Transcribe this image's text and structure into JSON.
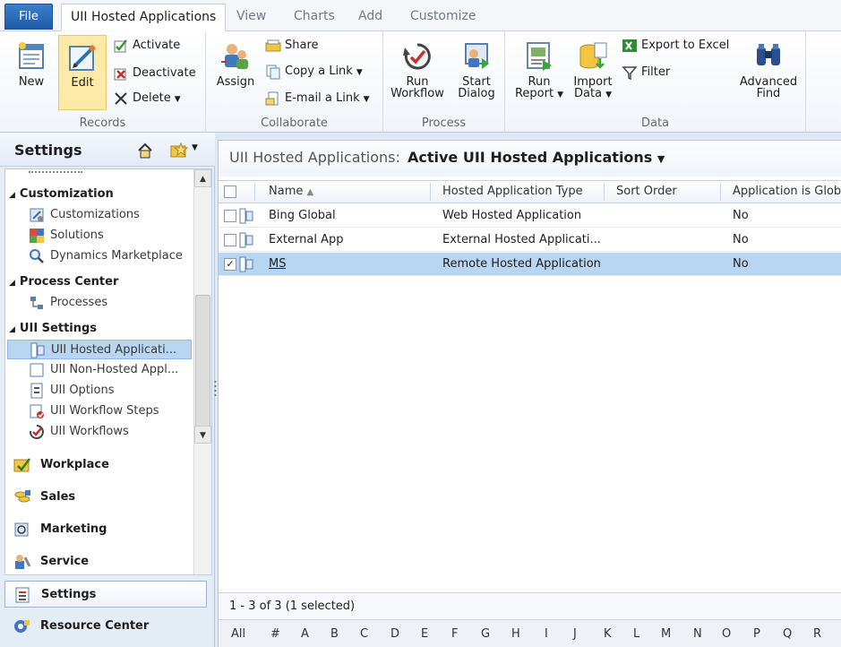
{
  "tabs": {
    "file": "File",
    "items": [
      "UII Hosted Applications",
      "View",
      "Charts",
      "Add",
      "Customize"
    ]
  },
  "ribbon": {
    "records": {
      "label": "Records",
      "new": "New",
      "edit": "Edit",
      "activate": "Activate",
      "deactivate": "Deactivate",
      "delete": "Delete"
    },
    "collaborate": {
      "label": "Collaborate",
      "assign": "Assign",
      "share": "Share",
      "copy_link": "Copy a Link",
      "email_link": "E-mail a Link"
    },
    "process": {
      "label": "Process",
      "run_workflow_1": "Run",
      "run_workflow_2": "Workflow",
      "start_dialog_1": "Start",
      "start_dialog_2": "Dialog"
    },
    "data": {
      "label": "Data",
      "run_report_1": "Run",
      "run_report_2": "Report",
      "import_data_1": "Import",
      "import_data_2": "Data",
      "export_excel": "Export to Excel",
      "filter": "Filter",
      "advanced_find_1": "Advanced",
      "advanced_find_2": "Find"
    }
  },
  "nav": {
    "title": "Settings",
    "sections": [
      {
        "title": "Customization",
        "items": [
          "Customizations",
          "Solutions",
          "Dynamics Marketplace"
        ]
      },
      {
        "title": "Process Center",
        "items": [
          "Processes"
        ]
      },
      {
        "title": "UII Settings",
        "items": [
          "UII Hosted Applicati...",
          "UII Non-Hosted Appl...",
          "UII Options",
          "UII Workflow Steps",
          "UII Workflows"
        ]
      }
    ],
    "areas": [
      "Workplace",
      "Sales",
      "Marketing",
      "Service",
      "Settings",
      "Resource Center"
    ]
  },
  "view": {
    "label": "UII Hosted Applications:",
    "name": "Active UII Hosted Applications"
  },
  "grid": {
    "columns": [
      "Name",
      "Hosted Application Type",
      "Sort Order",
      "Application is Glob"
    ],
    "rows": [
      {
        "name": "Bing Global",
        "type": "Web Hosted Application",
        "sort": "",
        "global": "No",
        "checked": ""
      },
      {
        "name": "External App",
        "type": "External Hosted Applicati...",
        "sort": "",
        "global": "No",
        "checked": ""
      },
      {
        "name": "MS",
        "type": "Remote Hosted Application",
        "sort": "",
        "global": "No",
        "checked": "✓"
      }
    ],
    "status": "1 - 3 of 3 (1 selected)",
    "alpha": [
      "All",
      "#",
      "A",
      "B",
      "C",
      "D",
      "E",
      "F",
      "G",
      "H",
      "I",
      "J",
      "K",
      "L",
      "M",
      "N",
      "O",
      "P",
      "Q",
      "R"
    ]
  }
}
